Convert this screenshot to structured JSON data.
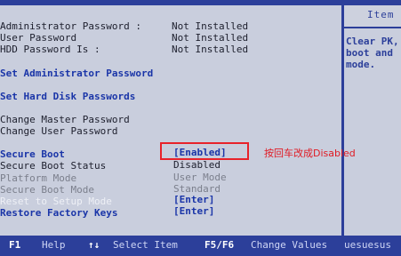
{
  "help_header": "Item",
  "help_text": [
    "Clear PK,",
    "boot and",
    "mode."
  ],
  "passwords": [
    {
      "label": "Administrator Password :",
      "value": "Not Installed"
    },
    {
      "label": "User Password",
      "value": "Not Installed"
    },
    {
      "label": "HDD Password Is :",
      "value": "Not Installed"
    }
  ],
  "links": {
    "set_admin": "Set Administrator Password",
    "set_hdd": "Set Hard Disk Passwords"
  },
  "change": {
    "master": "Change Master Password",
    "user": "Change User Password"
  },
  "secure": {
    "secure_boot_label": "Secure Boot",
    "secure_boot_value": "[Enabled]",
    "secure_boot_status_label": "Secure Boot Status",
    "secure_boot_status_value": "Disabled",
    "platform_mode_label": "Platform Mode",
    "platform_mode_value": "User Mode",
    "secure_boot_mode_label": "Secure Boot Mode",
    "secure_boot_mode_value": "Standard",
    "reset_label": "Reset to Setup Mode",
    "reset_value": "[Enter]",
    "restore_label": "Restore Factory Keys",
    "restore_value": "[Enter]"
  },
  "annotation": "按回车改成Disabled",
  "footer": [
    {
      "key": "F1",
      "desc": "Help"
    },
    {
      "key": "↑↓",
      "desc": "Select Item"
    },
    {
      "key": "F5/F6",
      "desc": "Change Values"
    },
    {
      "key": "",
      "desc": "uesuesus"
    }
  ],
  "colors": {
    "background": "#c9cedd",
    "frame": "#2c3f9a",
    "highlight": "#e8222a"
  }
}
